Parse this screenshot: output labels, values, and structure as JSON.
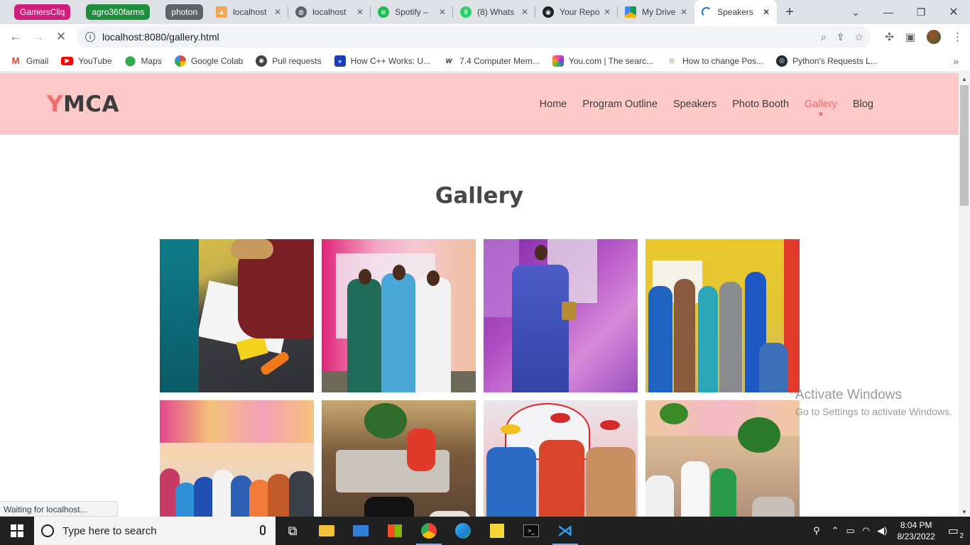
{
  "browser": {
    "tab_groups": [
      {
        "label": "GamersCliq",
        "color": "#d01f7a"
      },
      {
        "label": "agro360farms",
        "color": "#1e8e3e"
      },
      {
        "label": "photon",
        "color": "#5f6368"
      }
    ],
    "tabs": [
      {
        "title": "localhost",
        "icon": "pmia-icon"
      },
      {
        "title": "localhost",
        "icon": "globe-icon"
      },
      {
        "title": "Spotify – ",
        "icon": "spotify-icon"
      },
      {
        "title": "(8) Whats",
        "icon": "whatsapp-icon"
      },
      {
        "title": "Your Repo",
        "icon": "github-icon"
      },
      {
        "title": "My Drive",
        "icon": "drive-icon"
      },
      {
        "title": "Speakers",
        "icon": "loading-spinner-icon",
        "active": true
      }
    ],
    "new_tab": "+",
    "url": "localhost:8080/gallery.html",
    "bookmarks": [
      {
        "label": "Gmail",
        "icon": "gmail-icon"
      },
      {
        "label": "YouTube",
        "icon": "youtube-icon"
      },
      {
        "label": "Maps",
        "icon": "maps-icon"
      },
      {
        "label": "Google Colab",
        "icon": "colab-icon"
      },
      {
        "label": "Pull requests",
        "icon": "github-icon"
      },
      {
        "label": "How C++ Works: U...",
        "icon": "bookmark-blue-icon"
      },
      {
        "label": "7.4 Computer Mem...",
        "icon": "w-icon"
      },
      {
        "label": "You.com | The searc...",
        "icon": "youcom-icon"
      },
      {
        "label": "How to change Pos...",
        "icon": "stackoverflow-icon"
      },
      {
        "label": "Python's Requests L...",
        "icon": "realpython-icon"
      }
    ],
    "status_text": "Waiting for localhost..."
  },
  "site": {
    "logo_initial": "Y",
    "logo_rest": "MCA",
    "nav": [
      {
        "label": "Home",
        "active": false
      },
      {
        "label": "Program Outline",
        "active": false
      },
      {
        "label": "Speakers",
        "active": false
      },
      {
        "label": "Photo Booth",
        "active": false
      },
      {
        "label": "Gallery",
        "active": true
      },
      {
        "label": "Blog",
        "active": false
      }
    ],
    "heading": "Gallery",
    "accent_color": "#f46b6b",
    "header_bg": "#fec9c8",
    "photos": [
      {
        "label": "Signing attendance register",
        "scene": "register"
      },
      {
        "label": "Three guests in traditional attire",
        "scene": "trio"
      },
      {
        "label": "Award recipient in blue agbada",
        "scene": "award"
      },
      {
        "label": "Group reading on stage",
        "scene": "reading"
      },
      {
        "label": "Large group photo",
        "scene": "group"
      },
      {
        "label": "Guests seated at tables",
        "scene": "tables"
      },
      {
        "label": "Awardees holding plaques",
        "scene": "plaques"
      },
      {
        "label": "Reception hall with guests",
        "scene": "hall"
      }
    ]
  },
  "watermark": {
    "line1": "Activate Windows",
    "line2": "Go to Settings to activate Windows."
  },
  "taskbar": {
    "search_placeholder": "Type here to search",
    "time": "8:04 PM",
    "date": "8/23/2022",
    "notification_count": "2"
  }
}
